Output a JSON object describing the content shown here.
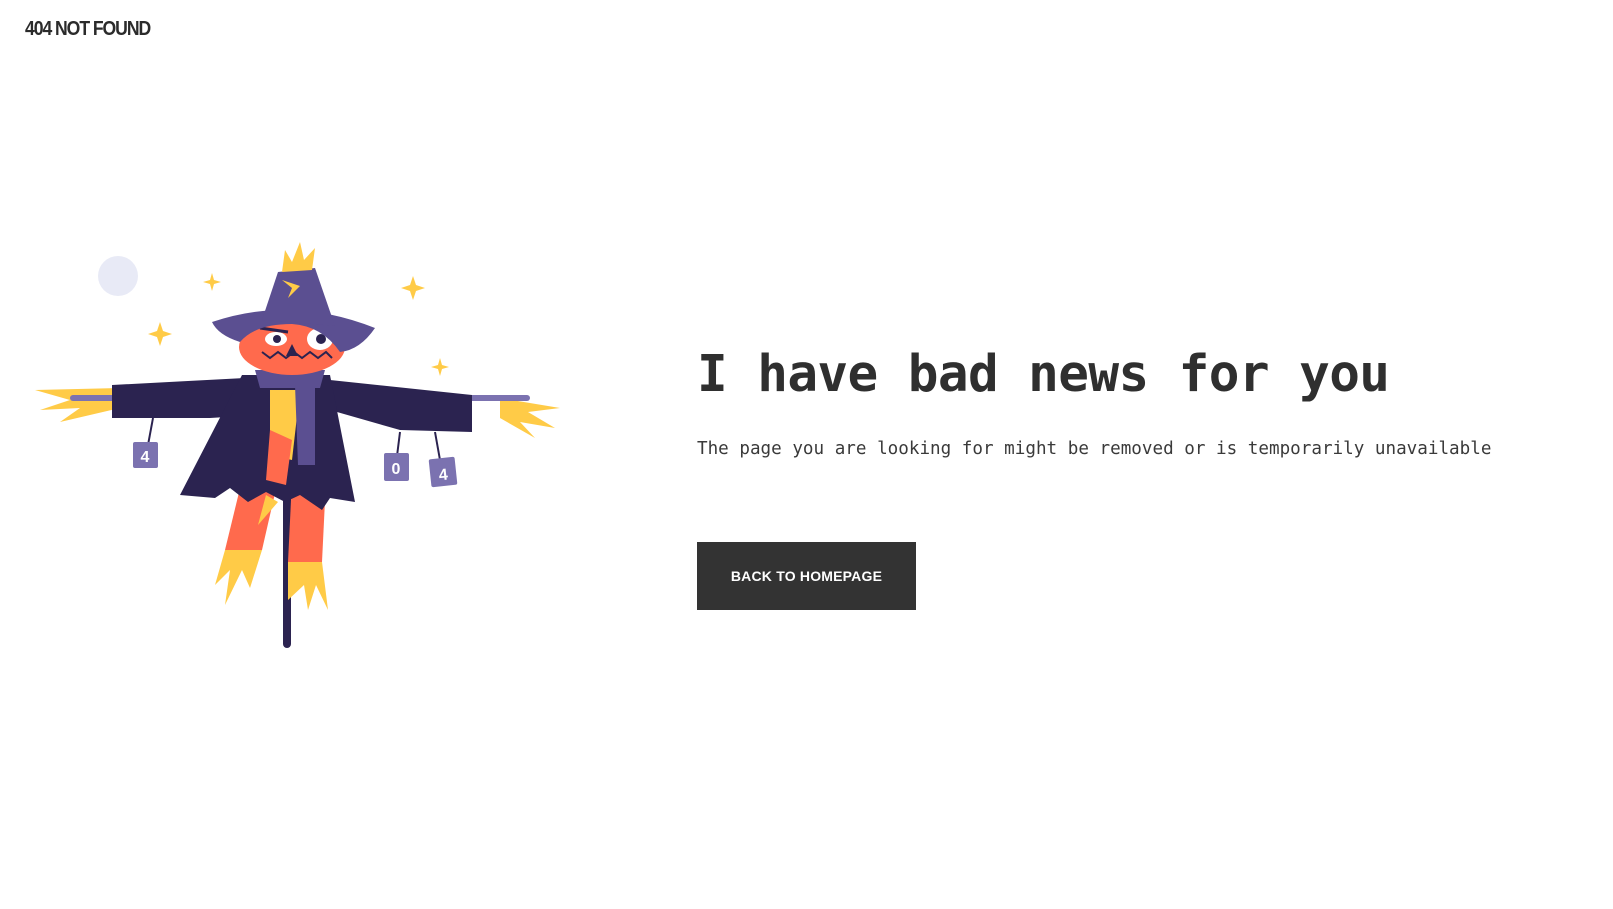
{
  "brand": {
    "label": "404 NOT FOUND"
  },
  "main": {
    "headline": "I have bad news for you",
    "subtext": "The page you are looking for might be removed or is temporarily unavailable",
    "button_label": "BACK TO HOMEPAGE"
  },
  "illustration": {
    "icon": "scarecrow-illustration",
    "tag_left": "4",
    "tag_middle": "0",
    "tag_right": "4"
  },
  "colors": {
    "text": "#2f2f2f",
    "button_bg": "#333333",
    "button_text": "#ffffff",
    "jacket": "#2b2350",
    "hat": "#5b4f91",
    "face": "#ff6a4d",
    "straw": "#ffcb47",
    "moon": "#e8eaf6",
    "tag": "#7b72b0"
  }
}
